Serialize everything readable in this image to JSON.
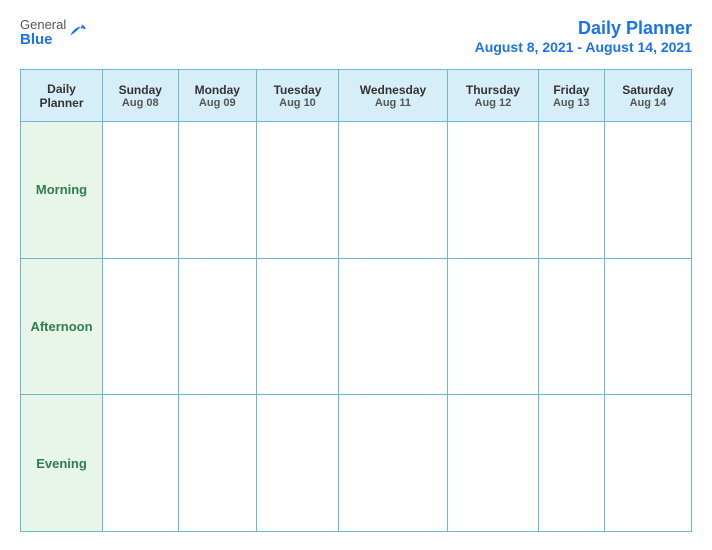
{
  "logo": {
    "general": "General",
    "blue": "Blue"
  },
  "title": {
    "main": "Daily Planner",
    "date_range": "August 8, 2021 - August 14, 2021"
  },
  "table": {
    "header_label_line1": "Daily",
    "header_label_line2": "Planner",
    "days": [
      {
        "name": "Sunday",
        "date": "Aug 08"
      },
      {
        "name": "Monday",
        "date": "Aug 09"
      },
      {
        "name": "Tuesday",
        "date": "Aug 10"
      },
      {
        "name": "Wednesday",
        "date": "Aug 11"
      },
      {
        "name": "Thursday",
        "date": "Aug 12"
      },
      {
        "name": "Friday",
        "date": "Aug 13"
      },
      {
        "name": "Saturday",
        "date": "Aug 14"
      }
    ],
    "rows": [
      {
        "label": "Morning"
      },
      {
        "label": "Afternoon"
      },
      {
        "label": "Evening"
      }
    ]
  }
}
